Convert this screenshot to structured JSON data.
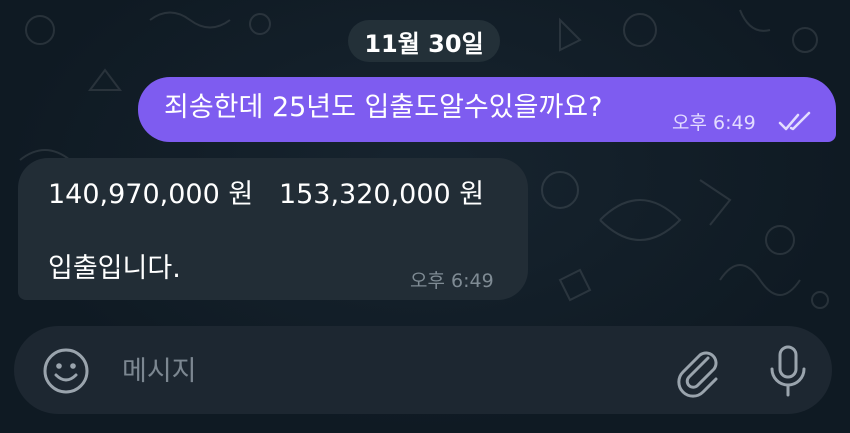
{
  "chat": {
    "date_label": "11월 30일",
    "messages": [
      {
        "direction": "outgoing",
        "text": "죄송한데 25년도 입출도알수있을까요?",
        "time": "오후 6:49",
        "status": "read"
      },
      {
        "direction": "incoming",
        "line1": "140,970,000 원   153,320,000 원",
        "line2": "입출입니다.",
        "time": "오후 6:49"
      }
    ]
  },
  "composer": {
    "placeholder": "메시지",
    "value": ""
  },
  "icons": {
    "emoji": "smiley-icon",
    "attach": "paperclip-icon",
    "mic": "microphone-icon",
    "read_status": "double-check-icon"
  },
  "colors": {
    "background": "#0f1a23",
    "outgoing_bubble": "#7e5cf0",
    "incoming_bubble": "#222d36",
    "composer": "#1d2731",
    "date_chip": "#233038"
  }
}
